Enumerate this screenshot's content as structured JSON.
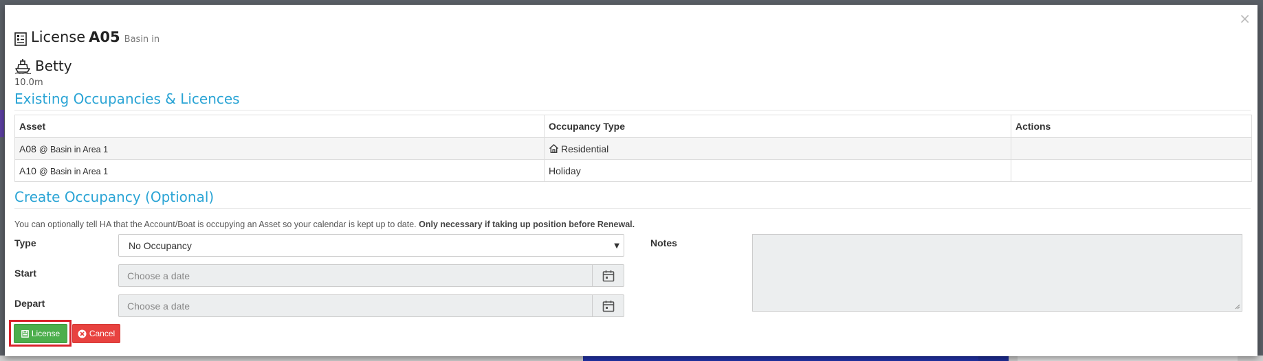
{
  "modal": {
    "close_label": "×",
    "title_prefix": "License",
    "title_code": "A05",
    "title_sub": "Basin in",
    "boat_name": "Betty",
    "boat_length": "10.0m"
  },
  "existing": {
    "heading": "Existing Occupancies & Licences",
    "columns": [
      "Asset",
      "Occupancy Type",
      "Actions"
    ],
    "rows": [
      {
        "asset": "A08",
        "location": "@ Basin in Area 1",
        "type": "Residential",
        "icon": "house-icon",
        "actions": ""
      },
      {
        "asset": "A10",
        "location": "@ Basin in Area 1",
        "type": "Holiday",
        "icon": "",
        "actions": ""
      }
    ]
  },
  "create": {
    "heading": "Create Occupancy (Optional)",
    "help": "You can optionally tell HA that the Account/Boat is occupying an Asset so your calendar is kept up to date.",
    "help_bold": "Only necessary if taking up position before Renewal.",
    "type_label": "Type",
    "type_value": "No Occupancy",
    "start_label": "Start",
    "start_placeholder": "Choose a date",
    "depart_label": "Depart",
    "depart_placeholder": "Choose a date",
    "notes_label": "Notes",
    "notes_value": ""
  },
  "buttons": {
    "license_label": "License",
    "cancel_label": "Cancel"
  },
  "colors": {
    "accent": "#2aa4d5",
    "license_green": "#4cae4c",
    "cancel_red": "#e8423f",
    "highlight": "#d9212a"
  }
}
